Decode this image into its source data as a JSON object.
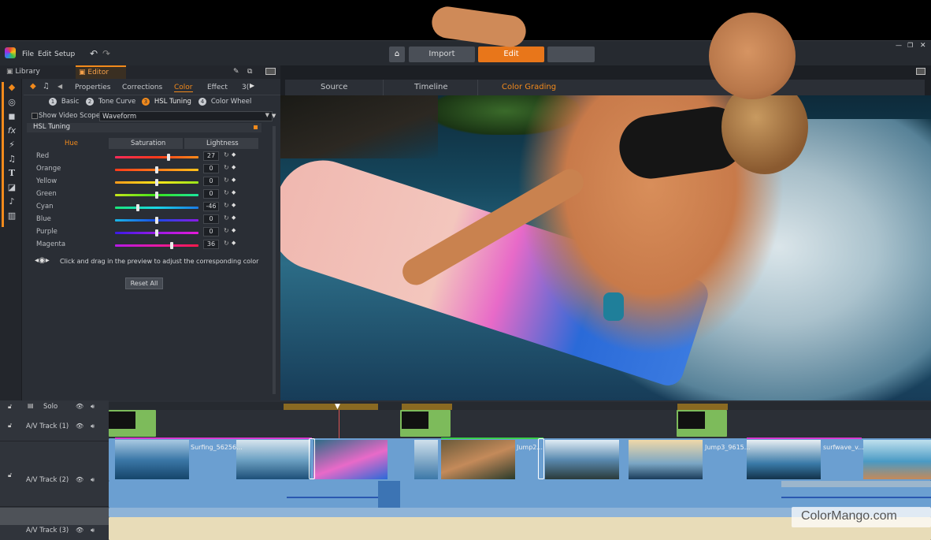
{
  "menu": [
    "File",
    "Edit",
    "Setup"
  ],
  "nav": {
    "import": "Import",
    "edit": "Edit"
  },
  "library_tab": "Library",
  "editor_tab": "Editor",
  "property_tabs": [
    "Properties",
    "Corrections",
    "Color",
    "Effect",
    "3("
  ],
  "sub_tabs": [
    {
      "num": "1",
      "label": "Basic"
    },
    {
      "num": "2",
      "label": "Tone Curve"
    },
    {
      "num": "3",
      "label": "HSL Tuning"
    },
    {
      "num": "4",
      "label": "Color Wheel"
    }
  ],
  "scope": {
    "label": "Show Video Scope",
    "value": "Waveform"
  },
  "hsl": {
    "title": "HSL Tuning",
    "columns": [
      "Hue",
      "Saturation",
      "Lightness"
    ],
    "rows": [
      {
        "label": "Red",
        "value": "27",
        "level": 0.64,
        "gradient": "linear-gradient(90deg,#ff2a5a,#ff3a1a,#ff8c1a)"
      },
      {
        "label": "Orange",
        "value": "0",
        "level": 0.5,
        "gradient": "linear-gradient(90deg,#ff3a1a,#ff7a1a,#ffc21a)"
      },
      {
        "label": "Yellow",
        "value": "0",
        "level": 0.5,
        "gradient": "linear-gradient(90deg,#ff9a1a,#ffe61a,#9ae61a)"
      },
      {
        "label": "Green",
        "value": "0",
        "level": 0.5,
        "gradient": "linear-gradient(90deg,#c8e61a,#3ae61a,#1ae6a0)"
      },
      {
        "label": "Cyan",
        "value": "-46",
        "level": 0.27,
        "gradient": "linear-gradient(90deg,#1ae67a,#1ad6e6,#1a7ae6)"
      },
      {
        "label": "Blue",
        "value": "0",
        "level": 0.5,
        "gradient": "linear-gradient(90deg,#1ab6e6,#1a4ae6,#8a1ae6)"
      },
      {
        "label": "Purple",
        "value": "0",
        "level": 0.5,
        "gradient": "linear-gradient(90deg,#3a1ae6,#9a1ae6,#e61ad6)"
      },
      {
        "label": "Magenta",
        "value": "36",
        "level": 0.68,
        "gradient": "linear-gradient(90deg,#b61ae6,#e61aa6,#ff1a4a)"
      }
    ],
    "hint": "Click and drag in the preview to adjust the corresponding color",
    "reset": "Reset All"
  },
  "preview_tabs": [
    "Source",
    "Timeline",
    "Color Grading"
  ],
  "tracks": [
    {
      "label": "Solo"
    },
    {
      "label": "A/V Track (1)"
    },
    {
      "label": "A/V Track (2)"
    },
    {
      "label": "A/V Track (3)"
    }
  ],
  "clips": [
    "Surfing_56256...",
    "Jump2...",
    "Jump3_9615...",
    "surf",
    "wave_v..."
  ],
  "watermark": "ColorMango.com",
  "colors": {
    "accent": "#f28a1c",
    "clip_blue": "#6b9fd1",
    "clip_green": "#7dbb5b"
  }
}
